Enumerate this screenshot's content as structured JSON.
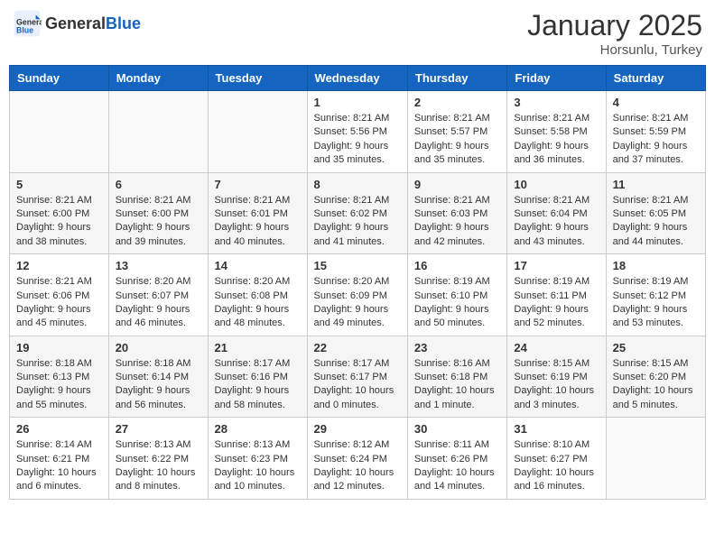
{
  "header": {
    "logo_general": "General",
    "logo_blue": "Blue",
    "month_title": "January 2025",
    "location": "Horsunlu, Turkey"
  },
  "weekdays": [
    "Sunday",
    "Monday",
    "Tuesday",
    "Wednesday",
    "Thursday",
    "Friday",
    "Saturday"
  ],
  "weeks": [
    [
      {
        "day": "",
        "info": ""
      },
      {
        "day": "",
        "info": ""
      },
      {
        "day": "",
        "info": ""
      },
      {
        "day": "1",
        "info": "Sunrise: 8:21 AM\nSunset: 5:56 PM\nDaylight: 9 hours and 35 minutes."
      },
      {
        "day": "2",
        "info": "Sunrise: 8:21 AM\nSunset: 5:57 PM\nDaylight: 9 hours and 35 minutes."
      },
      {
        "day": "3",
        "info": "Sunrise: 8:21 AM\nSunset: 5:58 PM\nDaylight: 9 hours and 36 minutes."
      },
      {
        "day": "4",
        "info": "Sunrise: 8:21 AM\nSunset: 5:59 PM\nDaylight: 9 hours and 37 minutes."
      }
    ],
    [
      {
        "day": "5",
        "info": "Sunrise: 8:21 AM\nSunset: 6:00 PM\nDaylight: 9 hours and 38 minutes."
      },
      {
        "day": "6",
        "info": "Sunrise: 8:21 AM\nSunset: 6:00 PM\nDaylight: 9 hours and 39 minutes."
      },
      {
        "day": "7",
        "info": "Sunrise: 8:21 AM\nSunset: 6:01 PM\nDaylight: 9 hours and 40 minutes."
      },
      {
        "day": "8",
        "info": "Sunrise: 8:21 AM\nSunset: 6:02 PM\nDaylight: 9 hours and 41 minutes."
      },
      {
        "day": "9",
        "info": "Sunrise: 8:21 AM\nSunset: 6:03 PM\nDaylight: 9 hours and 42 minutes."
      },
      {
        "day": "10",
        "info": "Sunrise: 8:21 AM\nSunset: 6:04 PM\nDaylight: 9 hours and 43 minutes."
      },
      {
        "day": "11",
        "info": "Sunrise: 8:21 AM\nSunset: 6:05 PM\nDaylight: 9 hours and 44 minutes."
      }
    ],
    [
      {
        "day": "12",
        "info": "Sunrise: 8:21 AM\nSunset: 6:06 PM\nDaylight: 9 hours and 45 minutes."
      },
      {
        "day": "13",
        "info": "Sunrise: 8:20 AM\nSunset: 6:07 PM\nDaylight: 9 hours and 46 minutes."
      },
      {
        "day": "14",
        "info": "Sunrise: 8:20 AM\nSunset: 6:08 PM\nDaylight: 9 hours and 48 minutes."
      },
      {
        "day": "15",
        "info": "Sunrise: 8:20 AM\nSunset: 6:09 PM\nDaylight: 9 hours and 49 minutes."
      },
      {
        "day": "16",
        "info": "Sunrise: 8:19 AM\nSunset: 6:10 PM\nDaylight: 9 hours and 50 minutes."
      },
      {
        "day": "17",
        "info": "Sunrise: 8:19 AM\nSunset: 6:11 PM\nDaylight: 9 hours and 52 minutes."
      },
      {
        "day": "18",
        "info": "Sunrise: 8:19 AM\nSunset: 6:12 PM\nDaylight: 9 hours and 53 minutes."
      }
    ],
    [
      {
        "day": "19",
        "info": "Sunrise: 8:18 AM\nSunset: 6:13 PM\nDaylight: 9 hours and 55 minutes."
      },
      {
        "day": "20",
        "info": "Sunrise: 8:18 AM\nSunset: 6:14 PM\nDaylight: 9 hours and 56 minutes."
      },
      {
        "day": "21",
        "info": "Sunrise: 8:17 AM\nSunset: 6:16 PM\nDaylight: 9 hours and 58 minutes."
      },
      {
        "day": "22",
        "info": "Sunrise: 8:17 AM\nSunset: 6:17 PM\nDaylight: 10 hours and 0 minutes."
      },
      {
        "day": "23",
        "info": "Sunrise: 8:16 AM\nSunset: 6:18 PM\nDaylight: 10 hours and 1 minute."
      },
      {
        "day": "24",
        "info": "Sunrise: 8:15 AM\nSunset: 6:19 PM\nDaylight: 10 hours and 3 minutes."
      },
      {
        "day": "25",
        "info": "Sunrise: 8:15 AM\nSunset: 6:20 PM\nDaylight: 10 hours and 5 minutes."
      }
    ],
    [
      {
        "day": "26",
        "info": "Sunrise: 8:14 AM\nSunset: 6:21 PM\nDaylight: 10 hours and 6 minutes."
      },
      {
        "day": "27",
        "info": "Sunrise: 8:13 AM\nSunset: 6:22 PM\nDaylight: 10 hours and 8 minutes."
      },
      {
        "day": "28",
        "info": "Sunrise: 8:13 AM\nSunset: 6:23 PM\nDaylight: 10 hours and 10 minutes."
      },
      {
        "day": "29",
        "info": "Sunrise: 8:12 AM\nSunset: 6:24 PM\nDaylight: 10 hours and 12 minutes."
      },
      {
        "day": "30",
        "info": "Sunrise: 8:11 AM\nSunset: 6:26 PM\nDaylight: 10 hours and 14 minutes."
      },
      {
        "day": "31",
        "info": "Sunrise: 8:10 AM\nSunset: 6:27 PM\nDaylight: 10 hours and 16 minutes."
      },
      {
        "day": "",
        "info": ""
      }
    ]
  ]
}
